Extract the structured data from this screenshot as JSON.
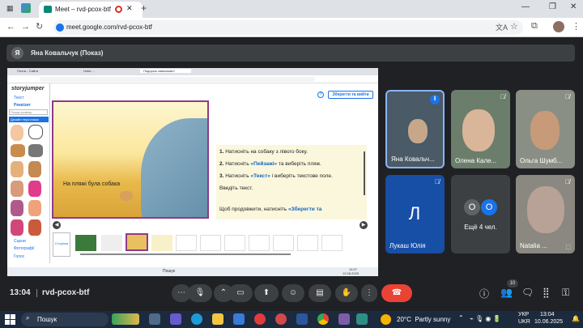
{
  "browser": {
    "tab_title": "Meet – rvd-pcox-btf",
    "url": "meet.google.com/rvd-pcox-btf"
  },
  "presenter": {
    "avatar_letter": "Я",
    "label": "Яна Ковальчук (Показ)"
  },
  "shared_screen": {
    "inner_tabs": [
      "Почта - Сайти",
      "Unter ...",
      "Подорож сваєкомаст"
    ],
    "sidebar": {
      "logo": "storyjumper",
      "section_text": "Текст",
      "section_props": "Реквізит",
      "search_placeholder": "Пошук реквізу",
      "design_label": "Дизайн персонажа",
      "scenes_label": "Сцени",
      "photos_label": "Фотографії",
      "voice_label": "Голос"
    },
    "save_button": "Зберегти та вийти",
    "page_caption": "На пляжі була собака",
    "instructions": [
      {
        "num": "1.",
        "text": "Натисніть на собаку з лівого боку."
      },
      {
        "num": "2.",
        "pre": "Натисніть ",
        "hl": "«Пейзажі»",
        "post": " та виберіть пляж."
      },
      {
        "num": "3.",
        "pre": "Натисніть ",
        "hl": "«Текст»",
        "post": " і виберіть текстове поле."
      },
      {
        "num": "",
        "text": "Введіть текст."
      }
    ],
    "continue_text": "Щоб продовжити, натисніть ",
    "continue_hl": "«Зберегти та",
    "add_page": "Сторінка",
    "inner_taskbar": {
      "search": "Пошук",
      "time": "15:27",
      "date": "12.06.2025"
    }
  },
  "participants": [
    {
      "name": "Яна Ковальч...",
      "muted": false
    },
    {
      "name": "Олена Кале...",
      "muted": true
    },
    {
      "name": "Ольга Шумб...",
      "muted": true
    },
    {
      "name": "Лукаш Юлія",
      "initial": "Л",
      "muted": true
    },
    {
      "name": "Ещё 4 чел.",
      "initials": [
        "О",
        "О"
      ]
    },
    {
      "name": "Natalia ...",
      "muted": true
    }
  ],
  "controls": {
    "time": "13:04",
    "meeting_code": "rvd-pcox-btf",
    "participants_count": "10"
  },
  "taskbar": {
    "search": "Пошук",
    "weather": "20°C  Partly sunny",
    "lang_top": "УКР",
    "lang_bottom": "UKR",
    "time": "13:04",
    "date": "10.06.2025"
  },
  "colors": {
    "meet_bg": "#202124",
    "end_call": "#ea4335",
    "accent_blue": "#1a73e8",
    "highlight": "#1565c0"
  }
}
